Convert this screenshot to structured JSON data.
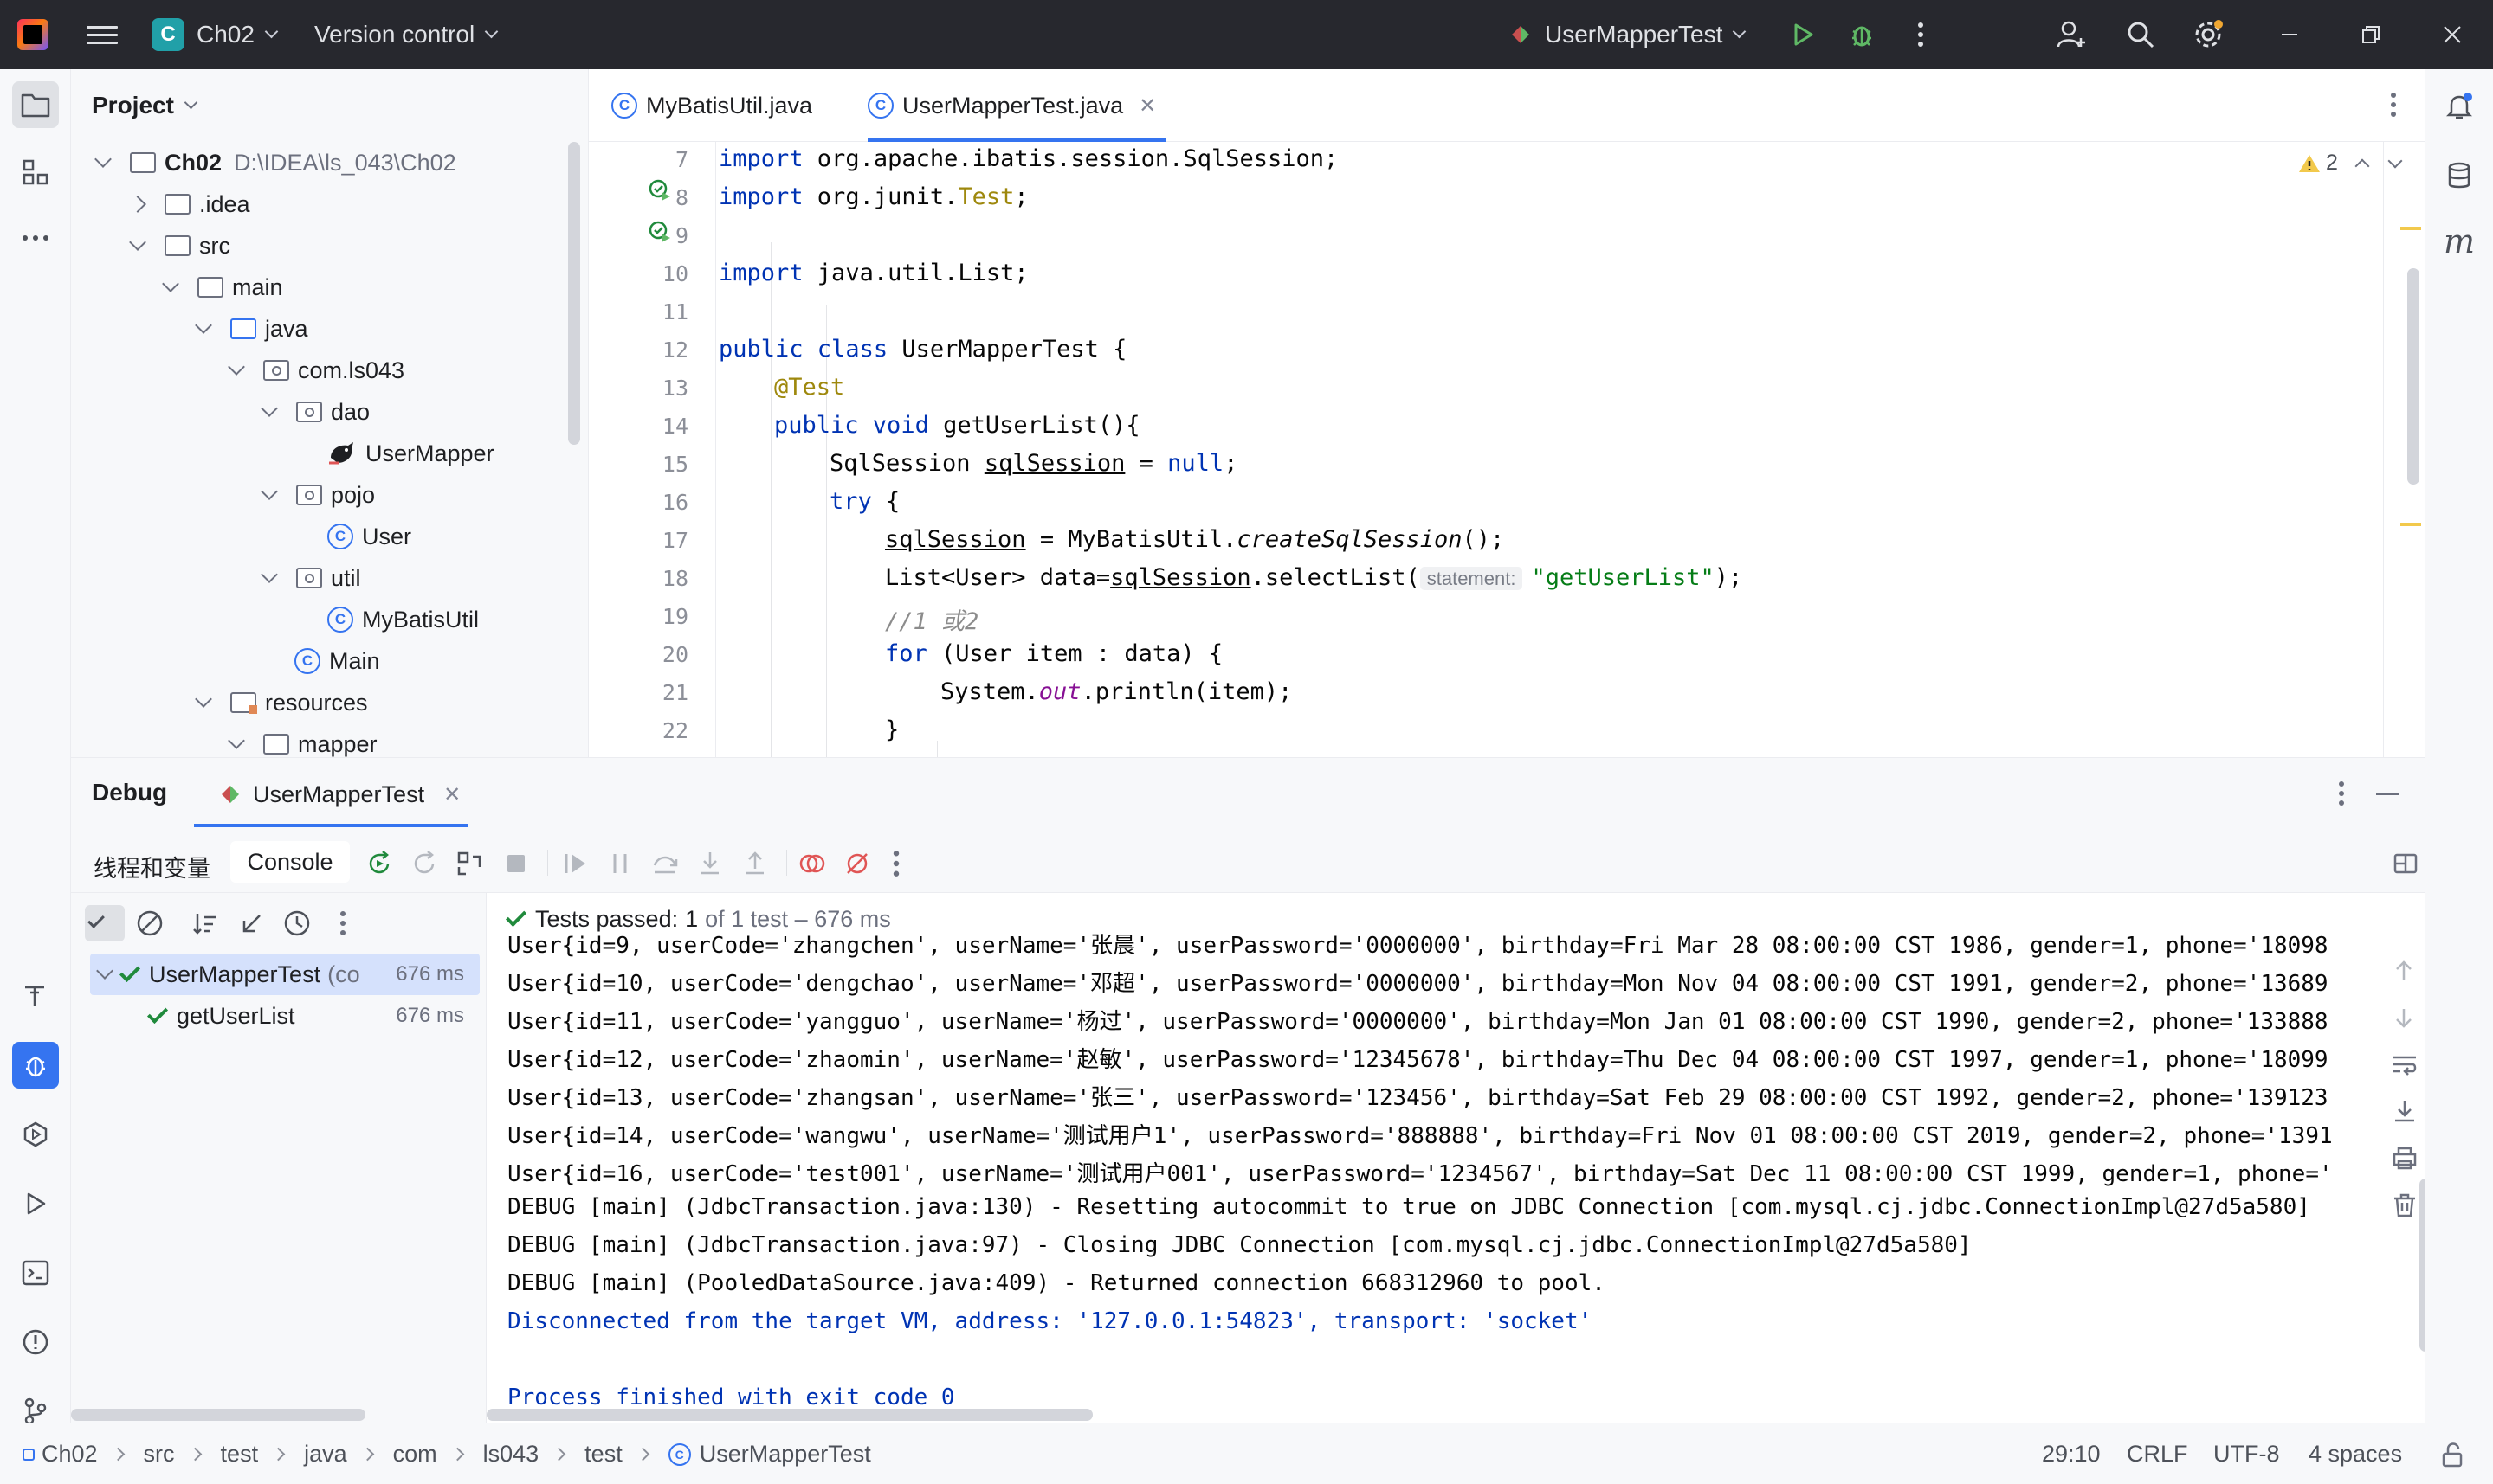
{
  "titlebar": {
    "project_badge": "C",
    "project_name": "Ch02",
    "version_control": "Version control",
    "run_config": "UserMapperTest"
  },
  "project_panel": {
    "title": "Project",
    "tree": [
      {
        "label": "Ch02",
        "path": "D:\\IDEA\\ls_043\\Ch02",
        "icon": "module-folder-icon",
        "expanded": true
      },
      {
        "label": ".idea",
        "icon": "folder-icon",
        "expanded": false
      },
      {
        "label": "src",
        "icon": "folder-icon",
        "expanded": true
      },
      {
        "label": "main",
        "icon": "folder-icon",
        "expanded": true
      },
      {
        "label": "java",
        "icon": "source-folder-icon",
        "expanded": true
      },
      {
        "label": "com.ls043",
        "icon": "package-icon",
        "expanded": true
      },
      {
        "label": "dao",
        "icon": "package-icon",
        "expanded": true
      },
      {
        "label": "UserMapper",
        "icon": "mybatis-mapper-icon"
      },
      {
        "label": "pojo",
        "icon": "package-icon",
        "expanded": true
      },
      {
        "label": "User",
        "icon": "class-icon"
      },
      {
        "label": "util",
        "icon": "package-icon",
        "expanded": true
      },
      {
        "label": "MyBatisUtil",
        "icon": "class-icon"
      },
      {
        "label": "Main",
        "icon": "class-icon"
      },
      {
        "label": "resources",
        "icon": "resources-folder-icon",
        "expanded": true
      },
      {
        "label": "mapper",
        "icon": "folder-icon",
        "expanded": true
      }
    ]
  },
  "editor": {
    "tabs": [
      {
        "label": "MyBatisUtil.java",
        "active": false
      },
      {
        "label": "UserMapperTest.java",
        "active": true
      }
    ],
    "warning_count": "2",
    "line_numbers": [
      "7",
      "8",
      "9",
      "10",
      "11",
      "12",
      "13",
      "14",
      "15",
      "16",
      "17",
      "18",
      "19",
      "20",
      "21",
      "22"
    ],
    "code": {
      "l7_kw": "import",
      "l7_rest": " org.apache.ibatis.session.SqlSession;",
      "l8_kw": "import",
      "l8_pkg": " org.junit.",
      "l8_ann": "Test",
      "l8_end": ";",
      "l10_kw": "import",
      "l10_rest": " java.util.List;",
      "l12_kw1": "public",
      "l12_kw2": " class",
      "l12_rest": " UserMapperTest {",
      "l13_ann": "@Test",
      "l14_kw1": "public",
      "l14_kw2": " void",
      "l14_rest": " getUserList(){",
      "l15_type": "SqlSession ",
      "l15_var": "sqlSession",
      "l15_eq": " = ",
      "l15_kw": "null",
      "l15_end": ";",
      "l16_kw": "try",
      "l16_rest": " {",
      "l17_var": "sqlSession",
      "l17_mid": " = MyBatisUtil.",
      "l17_call": "createSqlSession",
      "l17_end": "();",
      "l18_pre": "List<User> data=",
      "l18_var": "sqlSession",
      "l18_call": ".selectList(",
      "l18_hint": "statement:",
      "l18_str": "\"getUserList\"",
      "l18_end": ");",
      "l19_cmt": "//1 或2",
      "l20_kw": "for",
      "l20_rest": " (User item : data) {",
      "l21_pre": "System.",
      "l21_field": "out",
      "l21_end": ".println(item);",
      "l22": "}"
    }
  },
  "debug": {
    "title": "Debug",
    "session_tab": "UserMapperTest",
    "threads_label": "线程和变量",
    "console_label": "Console",
    "tests_passed_label": "Tests passed:",
    "tests_passed_count": "1",
    "tests_passed_detail": "of 1 test – 676 ms",
    "tests": [
      {
        "label": "UserMapperTest",
        "suffix": "(co",
        "time": "676 ms",
        "selected": true
      },
      {
        "label": "getUserList",
        "time": "676 ms",
        "selected": false
      }
    ],
    "console_lines": [
      {
        "text": "User{id=9, userCode='zhangchen', userName='张晨', userPassword='0000000', birthday=Fri Mar 28 08:00:00 CST 1986, gender=1, phone='18098",
        "kind": "debug"
      },
      {
        "text": "User{id=10, userCode='dengchao', userName='邓超', userPassword='0000000', birthday=Mon Nov 04 08:00:00 CST 1991, gender=2, phone='13689",
        "kind": "debug"
      },
      {
        "text": "User{id=11, userCode='yangguo', userName='杨过', userPassword='0000000', birthday=Mon Jan 01 08:00:00 CST 1990, gender=2, phone='133888",
        "kind": "debug"
      },
      {
        "text": "User{id=12, userCode='zhaomin', userName='赵敏', userPassword='12345678', birthday=Thu Dec 04 08:00:00 CST 1997, gender=1, phone='18099",
        "kind": "debug"
      },
      {
        "text": "User{id=13, userCode='zhangsan', userName='张三', userPassword='123456', birthday=Sat Feb 29 08:00:00 CST 1992, gender=2, phone='139123",
        "kind": "debug"
      },
      {
        "text": "User{id=14, userCode='wangwu', userName='测试用户1', userPassword='888888', birthday=Fri Nov 01 08:00:00 CST 2019, gender=2, phone='1391",
        "kind": "debug"
      },
      {
        "text": "User{id=16, userCode='test001', userName='测试用户001', userPassword='1234567', birthday=Sat Dec 11 08:00:00 CST 1999, gender=1, phone='",
        "kind": "debug"
      },
      {
        "text": "DEBUG [main] (JdbcTransaction.java:130) - Resetting autocommit to true on JDBC Connection [com.mysql.cj.jdbc.ConnectionImpl@27d5a580]",
        "kind": "debug"
      },
      {
        "text": "DEBUG [main] (JdbcTransaction.java:97) - Closing JDBC Connection [com.mysql.cj.jdbc.ConnectionImpl@27d5a580]",
        "kind": "debug"
      },
      {
        "text": "DEBUG [main] (PooledDataSource.java:409) - Returned connection 668312960 to pool.",
        "kind": "debug"
      },
      {
        "text": "Disconnected from the target VM, address: '127.0.0.1:54823', transport: 'socket'",
        "kind": "info"
      },
      {
        "text": "",
        "kind": "debug"
      },
      {
        "text": "Process finished with exit code 0",
        "kind": "info"
      }
    ]
  },
  "statusbar": {
    "breadcrumbs": [
      "Ch02",
      "src",
      "test",
      "java",
      "com",
      "ls043",
      "test",
      "UserMapperTest"
    ],
    "position": "29:10",
    "line_ending": "CRLF",
    "encoding": "UTF-8",
    "indent": "4 spaces"
  },
  "colors": {
    "accent": "#3574f0",
    "titlebar_bg": "#27282e",
    "pass_green": "#208a3c",
    "keyword": "#0033b3",
    "string": "#067d17",
    "annotation": "#9e880d"
  }
}
